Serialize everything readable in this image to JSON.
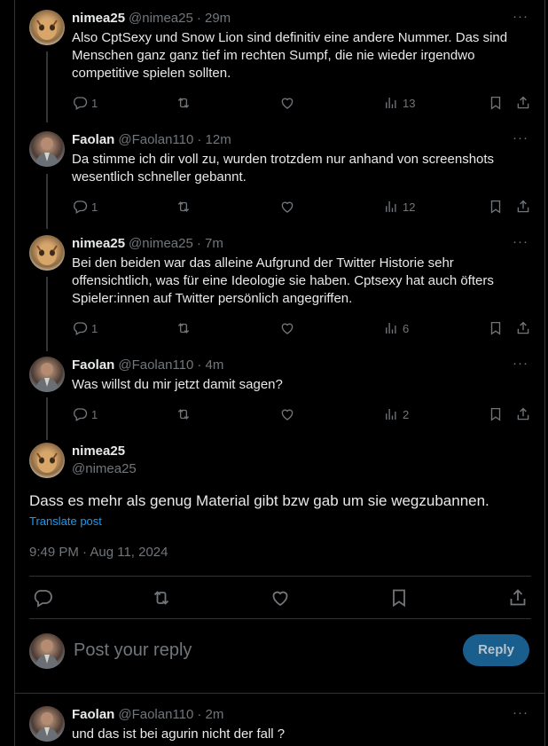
{
  "tweets": [
    {
      "author": "nimea25",
      "handle": "@nimea25",
      "time": "· 29m",
      "text": "Also CptSexy und Snow Lion sind definitiv eine andere Nummer. Das sind Menschen ganz ganz tief im rechten Sumpf, die nie wieder irgendwo competitive spielen sollten.",
      "replies": "1",
      "views": "13"
    },
    {
      "author": "Faolan",
      "handle": "@Faolan110",
      "time": "· 12m",
      "text": "Da stimme ich dir voll zu, wurden trotzdem nur anhand von screenshots wesentlich schneller gebannt.",
      "replies": "1",
      "views": "12"
    },
    {
      "author": "nimea25",
      "handle": "@nimea25",
      "time": "· 7m",
      "text": "Bei den beiden war das alleine Aufgrund der Twitter Historie sehr offensichtlich, was für eine Ideologie sie haben. Cptsexy hat auch öfters Spieler:innen auf Twitter persönlich angegriffen.",
      "replies": "1",
      "views": "6"
    },
    {
      "author": "Faolan",
      "handle": "@Faolan110",
      "time": "· 4m",
      "text": "Was willst du mir jetzt damit sagen?",
      "replies": "1",
      "views": "2"
    }
  ],
  "focused": {
    "author": "nimea25",
    "handle": "@nimea25",
    "text": "Dass es mehr als genug Material gibt bzw gab um sie wegzubannen.",
    "translate": "Translate post",
    "timestamp": "9:49 PM · Aug 11, 2024"
  },
  "composer": {
    "placeholder": "Post your reply",
    "button": "Reply"
  },
  "next_reply": {
    "author": "Faolan",
    "handle": "@Faolan110",
    "time": "· 2m",
    "text": "und das ist bei agurin nicht der fall ?"
  },
  "icons": {
    "more": "more-icon",
    "reply": "reply-icon",
    "repost": "repost-icon",
    "like": "like-icon",
    "views": "views-icon",
    "bookmark": "bookmark-icon",
    "share": "share-icon"
  },
  "colors": {
    "background": "#000000",
    "text": "#e7e9ea",
    "muted": "#71767b",
    "link": "#1d9bf0",
    "reply_button": "#1a5e8e"
  }
}
